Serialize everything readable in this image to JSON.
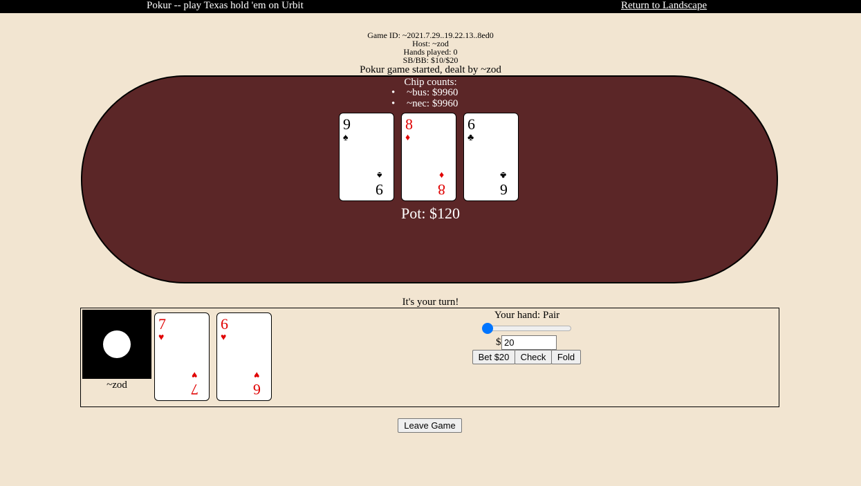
{
  "header": {
    "title": "Pokur -- play Texas hold 'em on Urbit",
    "return_label": "Return to Landscape"
  },
  "game": {
    "id": "Game ID: ~2021.7.29..19.22.13..8ed0",
    "host": "Host: ~zod",
    "hands_played": "Hands played: 0",
    "blinds": "SB/BB: $10/$20",
    "status": "Pokur game started, dealt by ~zod"
  },
  "table": {
    "chip_title": "Chip counts:",
    "chips": [
      {
        "bullet": "•",
        "text": "~bus: $9960"
      },
      {
        "bullet": "•",
        "text": "~nec: $9960"
      }
    ],
    "board": [
      {
        "rank": "9",
        "suit": "♠",
        "color": "black"
      },
      {
        "rank": "8",
        "suit": "♦",
        "color": "red"
      },
      {
        "rank": "6",
        "suit": "♣",
        "color": "black"
      }
    ],
    "pot": "Pot: $120"
  },
  "turn_message": "It's your turn!",
  "player": {
    "name": "~zod",
    "hand": [
      {
        "rank": "7",
        "suit": "♥",
        "color": "red"
      },
      {
        "rank": "6",
        "suit": "♥",
        "color": "red"
      }
    ],
    "hand_label": "Your hand: Pair",
    "bet_slider": {
      "value_fraction": 0.0
    },
    "currency": "$",
    "amount": "20",
    "buttons": {
      "bet": "Bet $20",
      "check": "Check",
      "fold": "Fold"
    }
  },
  "leave_label": "Leave Game",
  "colors": {
    "background": "#f2e5d1",
    "table": "#5b2627",
    "red_suit": "#e00000",
    "slider_accent": "#0075ff"
  }
}
